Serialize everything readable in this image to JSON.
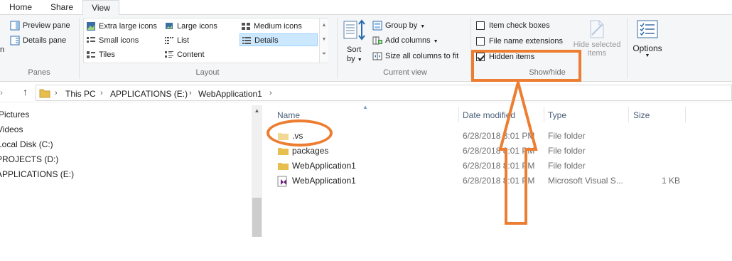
{
  "tabs": [
    {
      "label": "Home"
    },
    {
      "label": "Share"
    },
    {
      "label": "View",
      "active": true
    }
  ],
  "ribbon": {
    "panes": {
      "group_label": "Panes",
      "nav_pane_partial": "n",
      "preview_pane": "Preview pane",
      "details_pane": "Details pane"
    },
    "layout": {
      "group_label": "Layout",
      "items": [
        "Extra large icons",
        "Large icons",
        "Medium icons",
        "Small icons",
        "List",
        "Details",
        "Tiles",
        "Content"
      ],
      "selected": "Details"
    },
    "current_view": {
      "group_label": "Current view",
      "sort_label": "Sort",
      "sort_sub": "by",
      "group_by": "Group by",
      "add_columns": "Add columns",
      "size_all": "Size all columns to fit"
    },
    "show_hide": {
      "group_label": "Show/hide",
      "item_check_boxes": {
        "label": "Item check boxes",
        "checked": false
      },
      "file_name_extensions": {
        "label": "File name extensions",
        "checked": false
      },
      "hidden_items": {
        "label": "Hidden items",
        "checked": true
      },
      "hide_selected_line1": "Hide selected",
      "hide_selected_line2": "items"
    },
    "options": {
      "label": "Options"
    }
  },
  "address": {
    "crumbs": [
      "This PC",
      "APPLICATIONS (E:)",
      "WebApplication1"
    ]
  },
  "nav_pane": {
    "items": [
      "Pictures",
      "Videos",
      "Local Disk (C:)",
      "PROJECTS (D:)",
      "APPLICATIONS (E:)"
    ]
  },
  "columns": {
    "name": "Name",
    "date_modified": "Date modified",
    "type": "Type",
    "size": "Size"
  },
  "files": [
    {
      "name": ".vs",
      "date": "6/28/2018 8:01 PM",
      "type": "File folder",
      "size": "",
      "icon": "folder-icon"
    },
    {
      "name": "packages",
      "date": "6/28/2018 8:01 PM",
      "type": "File folder",
      "size": "",
      "icon": "folder-icon"
    },
    {
      "name": "WebApplication1",
      "date": "6/28/2018 8:01 PM",
      "type": "File folder",
      "size": "",
      "icon": "folder-icon"
    },
    {
      "name": "WebApplication1",
      "date": "6/28/2018 8:01 PM",
      "type": "Microsoft Visual S...",
      "size": "1 KB",
      "icon": "visual-studio-solution-icon"
    }
  ],
  "colors": {
    "accent_orange": "#ed7d31",
    "selection_blue": "#cce8ff",
    "folder_yellow": "#e8bf4f"
  }
}
